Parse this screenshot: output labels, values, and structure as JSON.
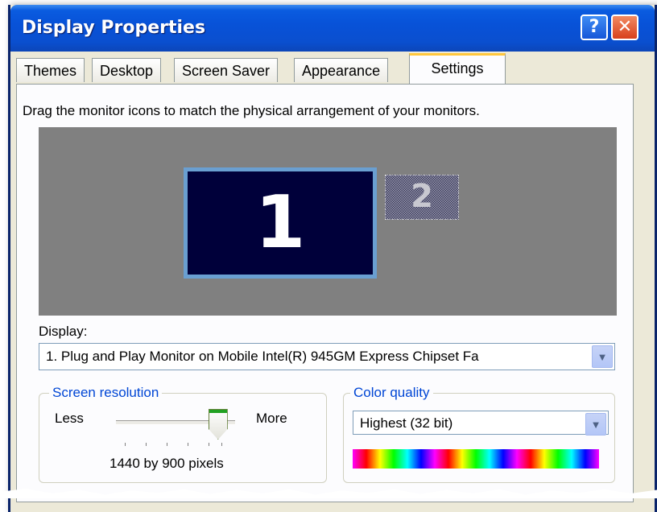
{
  "window": {
    "title": "Display Properties",
    "help_glyph": "?",
    "close_glyph": "✕"
  },
  "tabs": [
    {
      "label": "Themes",
      "active": false
    },
    {
      "label": "Desktop",
      "active": false
    },
    {
      "label": "Screen Saver",
      "active": false
    },
    {
      "label": "Appearance",
      "active": false
    },
    {
      "label": "Settings",
      "active": true
    }
  ],
  "settings": {
    "instructions": "Drag the monitor icons to match the physical arrangement of your monitors.",
    "monitors": [
      {
        "number": "1",
        "selected": true
      },
      {
        "number": "2",
        "selected": false
      }
    ],
    "display_label": "Display:",
    "display_value": "1. Plug and Play Monitor on Mobile Intel(R) 945GM Express Chipset Fa",
    "screen_resolution": {
      "legend": "Screen resolution",
      "less_label": "Less",
      "more_label": "More",
      "value_text": "1440 by 900 pixels",
      "slider_position": 0.85
    },
    "color_quality": {
      "legend": "Color quality",
      "selected": "Highest (32 bit)"
    },
    "dropdown_icon": "chevron-down-icon"
  },
  "colors": {
    "titlebar": "#0a5ce0",
    "dialog_bg": "#ece9d8",
    "monitor_area": "#808080",
    "monitor_fill": "#00003a",
    "monitor_border": "#6a9fd1",
    "group_legend": "#0046d5",
    "active_tab_accent": "#ffc73c"
  }
}
